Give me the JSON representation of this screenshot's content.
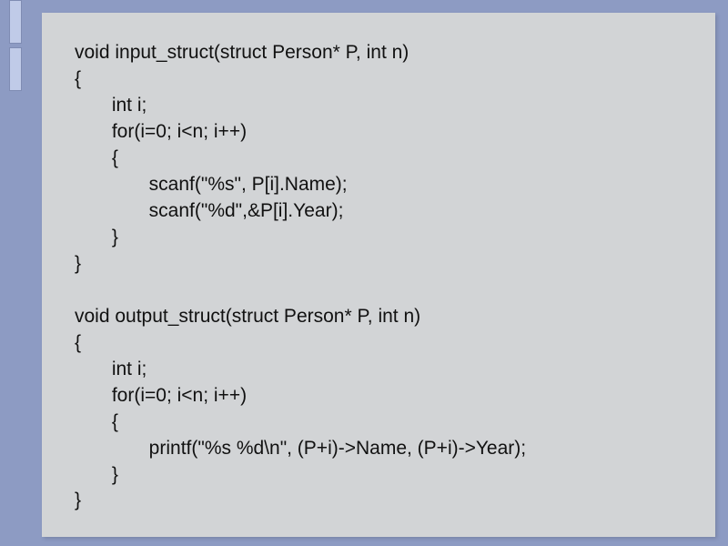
{
  "code": {
    "lines": [
      "void input_struct(struct Person* P, int n)",
      "{",
      "       int i;",
      "       for(i=0; i<n; i++)",
      "       {",
      "              scanf(\"%s\", P[i].Name);",
      "              scanf(\"%d\",&P[i].Year);",
      "       }",
      "}",
      "",
      "void output_struct(struct Person* P, int n)",
      "{",
      "       int i;",
      "       for(i=0; i<n; i++)",
      "       {",
      "              printf(\"%s %d\\n\", (P+i)->Name, (P+i)->Year);",
      "       }",
      "}"
    ]
  }
}
